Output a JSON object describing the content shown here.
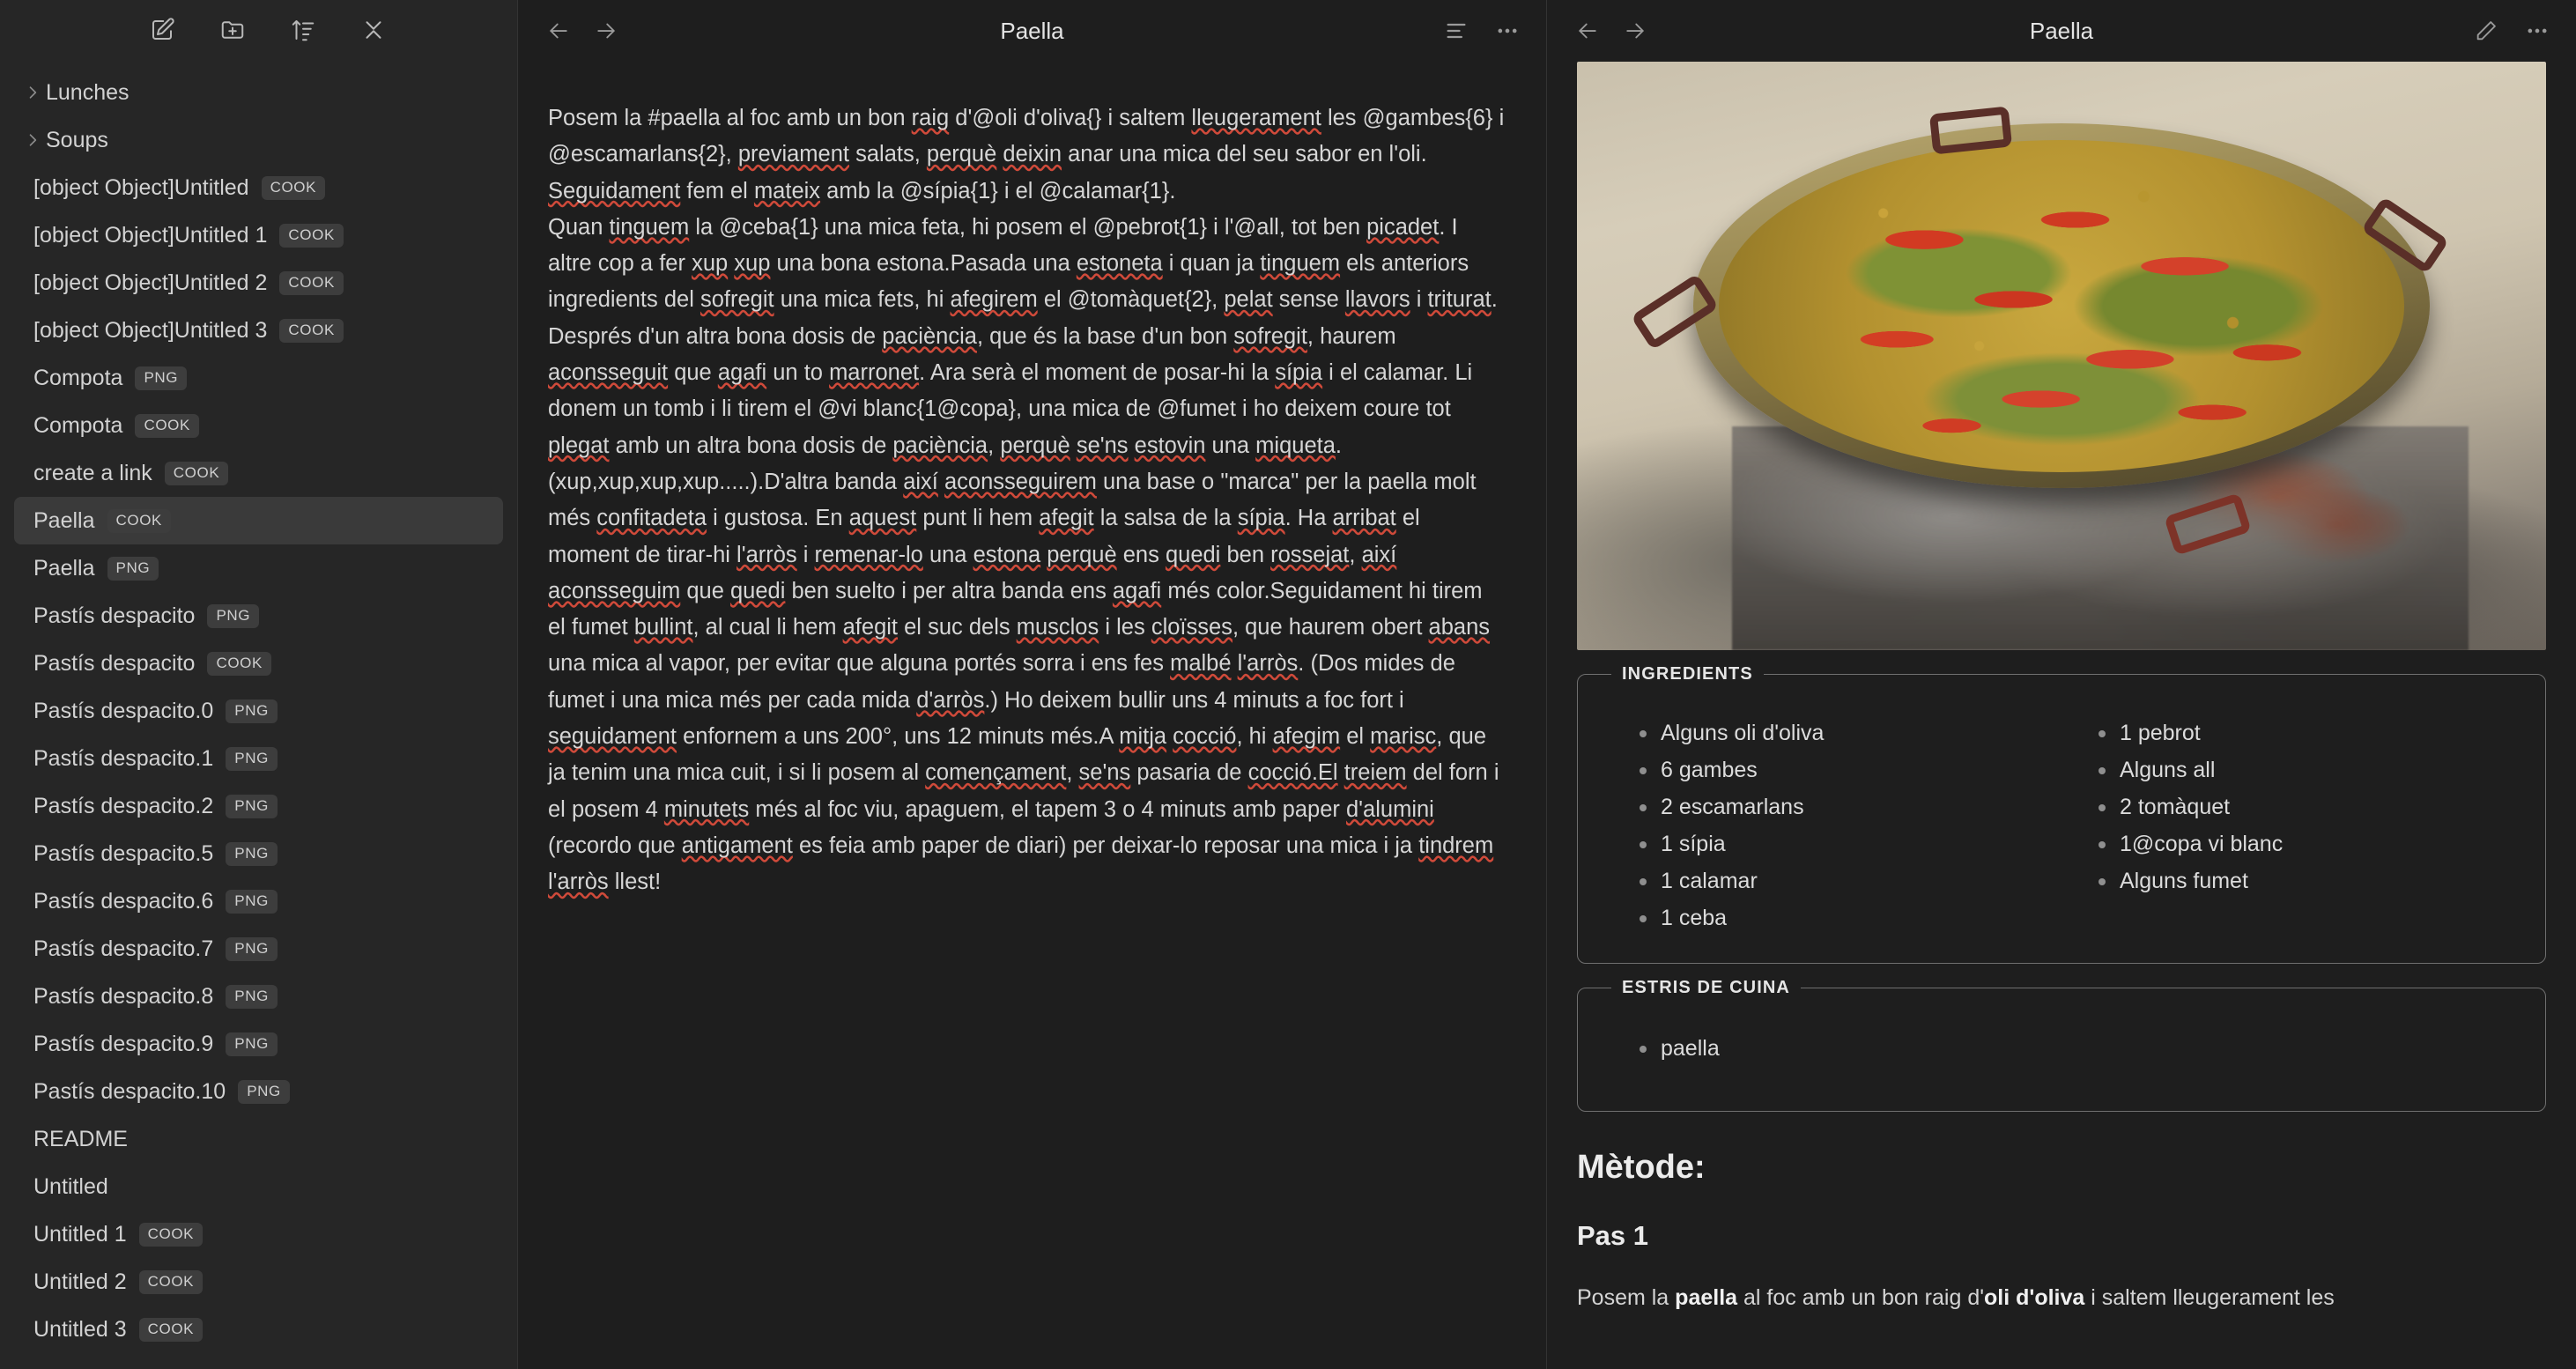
{
  "sidebar": {
    "toolbar": [
      {
        "icon": "new-note-icon"
      },
      {
        "icon": "new-folder-icon"
      },
      {
        "icon": "sort-icon"
      },
      {
        "icon": "collapse-all-icon"
      }
    ],
    "items": [
      {
        "label": "Lunches",
        "tag": "",
        "folder": true,
        "selected": false
      },
      {
        "label": "Soups",
        "tag": "",
        "folder": true,
        "selected": false
      },
      {
        "label": "[object Object]Untitled",
        "tag": "COOK",
        "folder": false,
        "selected": false
      },
      {
        "label": "[object Object]Untitled 1",
        "tag": "COOK",
        "folder": false,
        "selected": false
      },
      {
        "label": "[object Object]Untitled 2",
        "tag": "COOK",
        "folder": false,
        "selected": false
      },
      {
        "label": "[object Object]Untitled 3",
        "tag": "COOK",
        "folder": false,
        "selected": false
      },
      {
        "label": "Compota",
        "tag": "PNG",
        "folder": false,
        "selected": false
      },
      {
        "label": "Compota",
        "tag": "COOK",
        "folder": false,
        "selected": false
      },
      {
        "label": "create a link",
        "tag": "COOK",
        "folder": false,
        "selected": false
      },
      {
        "label": "Paella",
        "tag": "COOK",
        "folder": false,
        "selected": true
      },
      {
        "label": "Paella",
        "tag": "PNG",
        "folder": false,
        "selected": false
      },
      {
        "label": "Pastís despacito",
        "tag": "PNG",
        "folder": false,
        "selected": false
      },
      {
        "label": "Pastís despacito",
        "tag": "COOK",
        "folder": false,
        "selected": false
      },
      {
        "label": "Pastís despacito.0",
        "tag": "PNG",
        "folder": false,
        "selected": false
      },
      {
        "label": "Pastís despacito.1",
        "tag": "PNG",
        "folder": false,
        "selected": false
      },
      {
        "label": "Pastís despacito.2",
        "tag": "PNG",
        "folder": false,
        "selected": false
      },
      {
        "label": "Pastís despacito.5",
        "tag": "PNG",
        "folder": false,
        "selected": false
      },
      {
        "label": "Pastís despacito.6",
        "tag": "PNG",
        "folder": false,
        "selected": false
      },
      {
        "label": "Pastís despacito.7",
        "tag": "PNG",
        "folder": false,
        "selected": false
      },
      {
        "label": "Pastís despacito.8",
        "tag": "PNG",
        "folder": false,
        "selected": false
      },
      {
        "label": "Pastís despacito.9",
        "tag": "PNG",
        "folder": false,
        "selected": false
      },
      {
        "label": "Pastís despacito.10",
        "tag": "PNG",
        "folder": false,
        "selected": false
      },
      {
        "label": "README",
        "tag": "",
        "folder": false,
        "selected": false
      },
      {
        "label": "Untitled",
        "tag": "",
        "folder": false,
        "selected": false
      },
      {
        "label": "Untitled 1",
        "tag": "COOK",
        "folder": false,
        "selected": false
      },
      {
        "label": "Untitled 2",
        "tag": "COOK",
        "folder": false,
        "selected": false
      },
      {
        "label": "Untitled 3",
        "tag": "COOK",
        "folder": false,
        "selected": false
      }
    ]
  },
  "editor": {
    "title": "Paella",
    "toolbar_icons": [
      "back-icon",
      "forward-icon",
      "outline-icon",
      "more-options-icon"
    ],
    "content_paragraphs": [
      "Posem la #paella al foc amb un bon raig d'@oli d'oliva{} i saltem lleugerament les @gambes{6} i @escamarlans{2}, previament salats, perquè deixin anar una mica del seu sabor en l'oli. Seguidament fem el mateix amb la @sípia{1} i el @calamar{1}.",
      "Quan tinguem la @ceba{1} una mica feta, hi posem el @pebrot{1} i l'@all, tot ben picadet. I altre cop a fer xup xup una bona estona.Pasada una estoneta i quan ja tinguem els anteriors ingredients del sofregit una mica fets, hi afegirem el @tomàquet{2}, pelat sense llavors i triturat. Després d'un altra bona dosis de paciència, que és la base d'un bon sofregit, haurem aconsseguit que agafi un to marronet. Ara serà el moment de posar-hi la sípia i el calamar. Li donem un tomb i li tirem el @vi blanc{1@copa}, una mica de @fumet i ho deixem coure tot plegat amb un altra bona dosis de paciència, perquè se'ns estovin una miqueta. (xup,xup,xup,xup.....).D'altra banda així aconsseguirem una base o \"marca\" per la paella molt més confitadeta i gustosa. En aquest punt li hem afegit la salsa de la sípia. Ha arribat el moment de tirar-hi l'arròs i remenar-lo una estona perquè ens quedi ben rossejat, així aconsseguim que quedi ben suelto i per altra banda ens agafi més color.Seguidament hi tirem el fumet bullint, al cual li hem afegit el suc dels musclos i les cloïsses, que haurem obert abans una mica al vapor, per evitar que alguna portés sorra i ens fes malbé l'arròs. (Dos mides de fumet i una mica més per cada mida d'arròs.) Ho deixem bullir uns 4 minuts a foc fort i seguidament enfornem a uns 200°, uns 12 minuts més.A mitja cocció, hi afegim el marisc, que ja tenim una mica cuit, i si li posem al començament, se'ns pasaria de cocció.El treiem del forn i el posem 4 minutets més al foc viu, apaguem, el tapem 3 o 4 minuts amb paper d'alumini (recordo que antigament es feia amb paper de diari) per deixar-lo reposar una mica i ja tindrem l'arròs llest!"
    ]
  },
  "preview": {
    "title": "Paella",
    "toolbar_icons": [
      "back-icon",
      "forward-icon",
      "edit-icon",
      "more-options-icon"
    ],
    "image_alt": "paella pan cooking over embers",
    "ingredients_legend": "INGREDIENTS",
    "ingredients_left": [
      "Alguns oli d'oliva",
      "6 gambes",
      "2 escamarlans",
      "1 sípia",
      "1 calamar",
      "1 ceba"
    ],
    "ingredients_right": [
      "1 pebrot",
      "Alguns all",
      "2 tomàquet",
      "1@copa vi blanc",
      "Alguns fumet"
    ],
    "tools_legend": "ESTRIS DE CUINA",
    "tools": [
      "paella"
    ],
    "method_heading": "Mètode:",
    "step_heading": "Pas 1",
    "step_text_pre": "Posem la ",
    "step_bold_1": "paella",
    "step_text_mid": " al foc amb un bon raig d'",
    "step_bold_2": "oli d'oliva",
    "step_text_post": " i saltem lleugerament les"
  },
  "colors": {
    "background": "#1e1e1e",
    "sidebar_background": "#262626",
    "selected_row": "#3a3a3a",
    "tag_background": "#3d3d3d",
    "text_primary": "#d6d6d6",
    "spellcheck_underline": "#d04a3a",
    "box_border": "#6f6f6f"
  }
}
